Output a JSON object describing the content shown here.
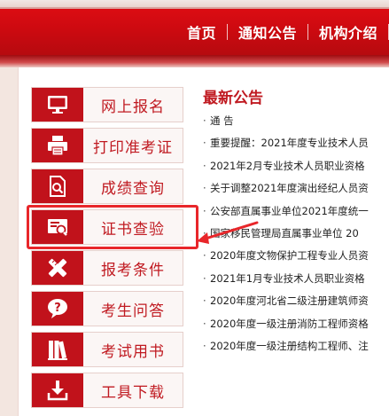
{
  "nav": {
    "items": [
      "首页",
      "通知公告",
      "机构介绍"
    ]
  },
  "sidebar": {
    "items": [
      {
        "label": "网上报名",
        "icon": "monitor-icon"
      },
      {
        "label": "打印准考证",
        "icon": "printer-icon"
      },
      {
        "label": "成绩查询",
        "icon": "document-search-icon"
      },
      {
        "label": "证书查验",
        "icon": "certificate-search-icon",
        "highlighted": true
      },
      {
        "label": "报考条件",
        "icon": "pencil-ruler-icon"
      },
      {
        "label": "考生问答",
        "icon": "question-bubble-icon"
      },
      {
        "label": "考试用书",
        "icon": "books-icon"
      },
      {
        "label": "工具下载",
        "icon": "download-icon"
      }
    ]
  },
  "news": {
    "title": "最新公告",
    "items": [
      "通 告",
      "重要提醒：2021年度专业技术人员",
      "2021年2月专业技术人员职业资格",
      "关于调整2021年度演出经纪人员资",
      "公安部直属事业单位2021年度统一",
      "国家移民管理局直属事业单位 20",
      "2020年度文物保护工程专业人员资",
      "2021年1月专业技术人员职业资格",
      "2020年度河北省二级注册建筑师资",
      "2020年度一级注册消防工程师资格",
      "2020年度一级注册结构工程师、注"
    ]
  },
  "colors": {
    "brand_red": "#c1121b",
    "highlight_red": "#e8262a"
  }
}
